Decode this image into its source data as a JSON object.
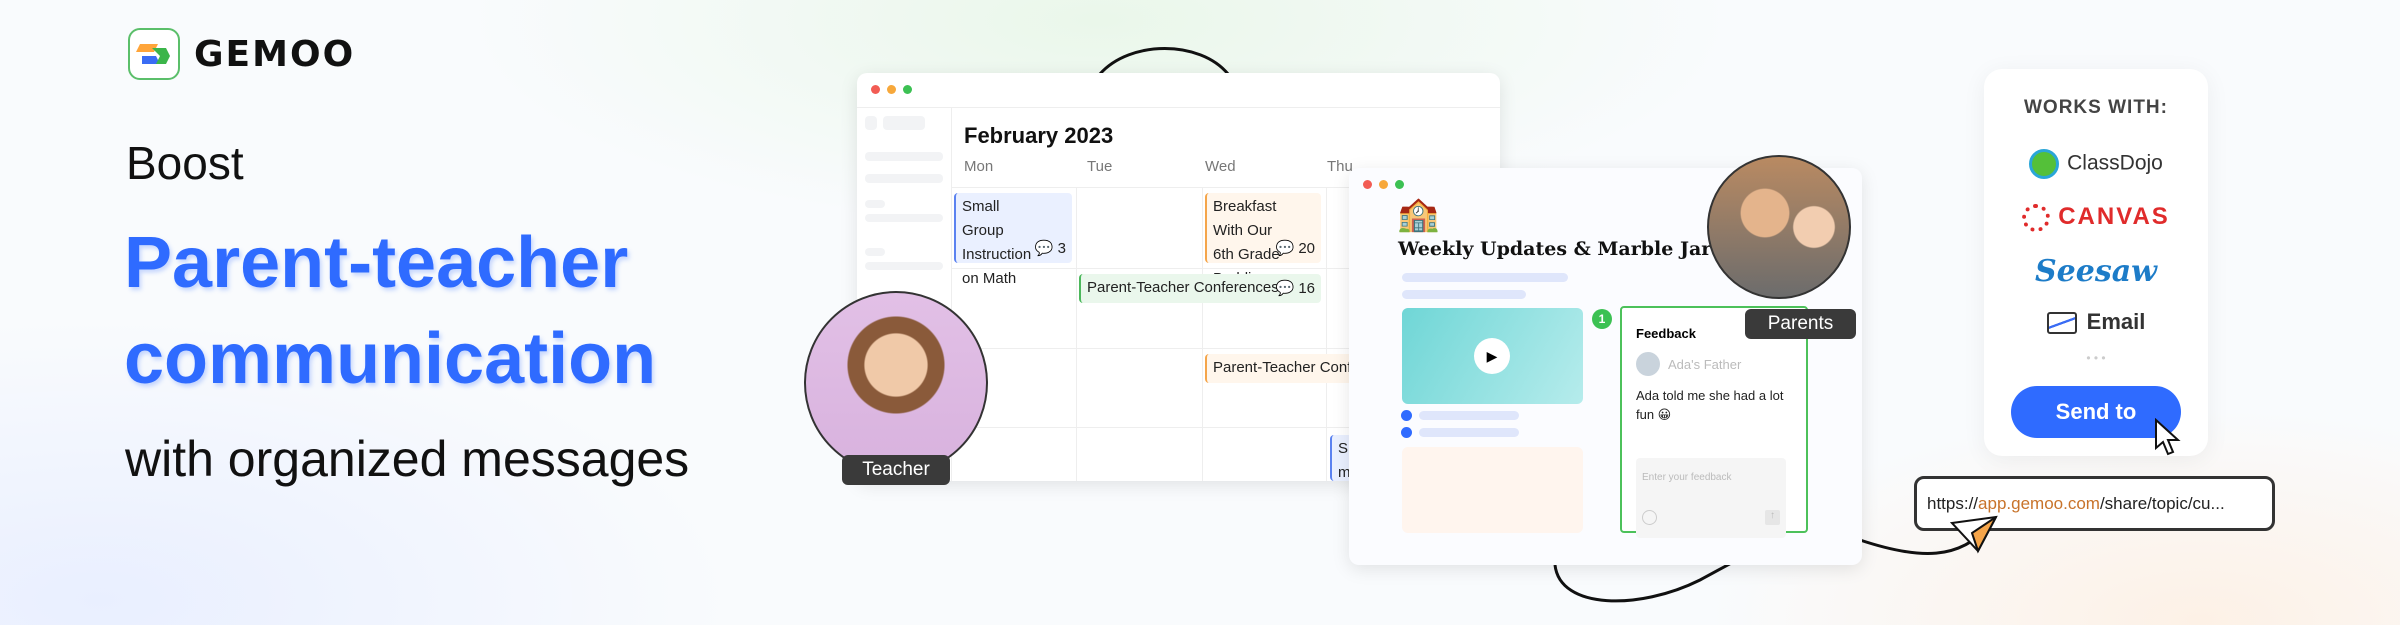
{
  "brand": {
    "name": "GEMOO"
  },
  "headline": {
    "line1": "Boost",
    "line2": "Parent-teacher",
    "line3": "communication",
    "line4": "with organized messages",
    "accent": "#2f6bff"
  },
  "calendar": {
    "title": "February  2023",
    "days": [
      "Mon",
      "Tue",
      "Wed",
      "Thu"
    ],
    "events": [
      {
        "title": "Small Group Instruction on Math",
        "count": "3"
      },
      {
        "title": "Breakfast With Our 6th Grade Buddies",
        "count": "20"
      },
      {
        "title": "Parent-Teacher Conferences",
        "count": "16"
      },
      {
        "title": "Parent-Teacher Conf"
      },
      {
        "title": "Sm In"
      }
    ]
  },
  "teacher_label": "Teacher",
  "parents_label": "Parents",
  "post": {
    "title": "Weekly Updates & Marble Jar Party!",
    "badge": "1",
    "feedback": {
      "heading": "Feedback",
      "author": "Ada's Father",
      "message": "Ada told me she had a lot fun 😀",
      "placeholder": "Enter your feedback"
    }
  },
  "works_with": {
    "heading": "WORKS WITH:",
    "items": [
      "ClassDojo",
      "CANVAS",
      "Seesaw",
      "Email"
    ],
    "more": "• • •",
    "button": "Send to"
  },
  "share_url": {
    "prefix": "https://",
    "domain": "app.gemoo.com",
    "path": "/share/topic/cu..."
  }
}
